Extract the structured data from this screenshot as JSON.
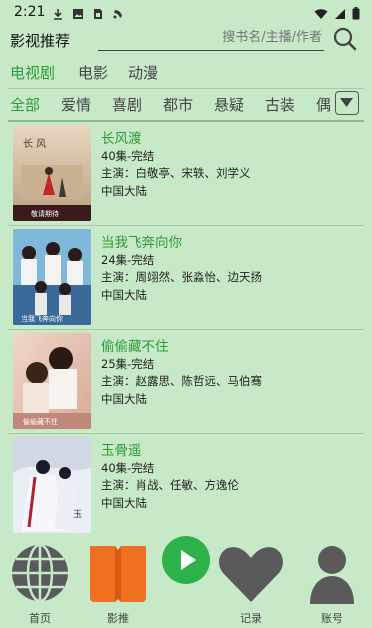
{
  "status_bar": {
    "time": "2:21",
    "left_icons": [
      "download-icon",
      "image-icon",
      "sim-icon",
      "notification-icon"
    ],
    "right_icons": [
      "wifi-icon",
      "signal-icon",
      "battery-icon"
    ]
  },
  "header": {
    "title": "影视推荐",
    "search_placeholder": "搜书名/主播/作者"
  },
  "category_tabs": [
    {
      "label": "电视剧",
      "active": true
    },
    {
      "label": "电影",
      "active": false
    },
    {
      "label": "动漫",
      "active": false
    }
  ],
  "genre_tabs": [
    {
      "label": "全部",
      "active": true
    },
    {
      "label": "爱情",
      "active": false
    },
    {
      "label": "喜剧",
      "active": false
    },
    {
      "label": "都市",
      "active": false
    },
    {
      "label": "悬疑",
      "active": false
    },
    {
      "label": "古装",
      "active": false
    },
    {
      "label": "偶",
      "active": false
    }
  ],
  "list": [
    {
      "title": "长风渡",
      "episodes": "40集-完结",
      "cast": "主演：白敬亭、宋轶、刘学义",
      "region": "中国大陆"
    },
    {
      "title": "当我飞奔向你",
      "episodes": "24集-完结",
      "cast": "主演：周翊然、张淼怡、边天扬",
      "region": "中国大陆"
    },
    {
      "title": "偷偷藏不住",
      "episodes": "25集-完结",
      "cast": "主演：赵露思、陈哲远、马伯骞",
      "region": "中国大陆"
    },
    {
      "title": "玉骨遥",
      "episodes": "40集-完结",
      "cast": "主演：肖战、任敏、方逸伦",
      "region": "中国大陆"
    }
  ],
  "bottom_nav": [
    {
      "label": "首页",
      "icon": "globe-icon"
    },
    {
      "label": "影推",
      "icon": "book-icon"
    },
    {
      "label": "",
      "icon": "play-icon"
    },
    {
      "label": "记录",
      "icon": "heart-icon"
    },
    {
      "label": "账号",
      "icon": "user-icon"
    }
  ],
  "colors": {
    "background": "#c7e9c8",
    "accent": "#2e9a38",
    "book_icon": "#f07020",
    "play_button": "#2db24a",
    "nav_icon": "#555555"
  }
}
